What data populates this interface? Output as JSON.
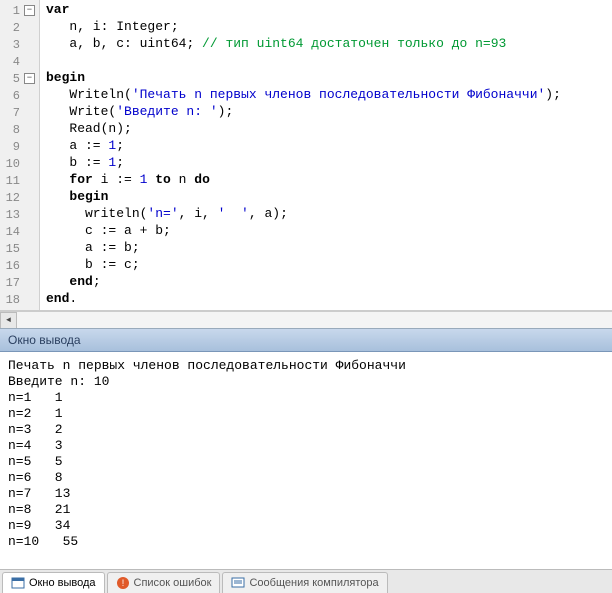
{
  "code": {
    "lines": [
      {
        "n": 1,
        "fold": true,
        "tokens": [
          {
            "t": "kw",
            "v": "var"
          }
        ]
      },
      {
        "n": 2,
        "tokens": [
          {
            "t": "",
            "v": "   n, i: "
          },
          {
            "t": "type",
            "v": "Integer"
          },
          {
            "t": "",
            "v": ";"
          }
        ]
      },
      {
        "n": 3,
        "tokens": [
          {
            "t": "",
            "v": "   a, b, c: "
          },
          {
            "t": "type",
            "v": "uint64"
          },
          {
            "t": "",
            "v": "; "
          },
          {
            "t": "cmt",
            "v": "// тип uint64 достаточен только до n=93"
          }
        ]
      },
      {
        "n": 4,
        "tokens": []
      },
      {
        "n": 5,
        "fold": true,
        "tokens": [
          {
            "t": "kw",
            "v": "begin"
          }
        ]
      },
      {
        "n": 6,
        "tokens": [
          {
            "t": "",
            "v": "   Writeln("
          },
          {
            "t": "str",
            "v": "'Печать n первых членов последовательности Фибоначчи'"
          },
          {
            "t": "",
            "v": ");"
          }
        ]
      },
      {
        "n": 7,
        "tokens": [
          {
            "t": "",
            "v": "   Write("
          },
          {
            "t": "str",
            "v": "'Введите n: '"
          },
          {
            "t": "",
            "v": ");"
          }
        ]
      },
      {
        "n": 8,
        "tokens": [
          {
            "t": "",
            "v": "   Read(n);"
          }
        ]
      },
      {
        "n": 9,
        "tokens": [
          {
            "t": "",
            "v": "   a := "
          },
          {
            "t": "num",
            "v": "1"
          },
          {
            "t": "",
            "v": ";"
          }
        ]
      },
      {
        "n": 10,
        "tokens": [
          {
            "t": "",
            "v": "   b := "
          },
          {
            "t": "num",
            "v": "1"
          },
          {
            "t": "",
            "v": ";"
          }
        ]
      },
      {
        "n": 11,
        "tokens": [
          {
            "t": "",
            "v": "   "
          },
          {
            "t": "kw",
            "v": "for"
          },
          {
            "t": "",
            "v": " i := "
          },
          {
            "t": "num",
            "v": "1"
          },
          {
            "t": "",
            "v": " "
          },
          {
            "t": "kw",
            "v": "to"
          },
          {
            "t": "",
            "v": " n "
          },
          {
            "t": "kw",
            "v": "do"
          }
        ]
      },
      {
        "n": 12,
        "tokens": [
          {
            "t": "",
            "v": "   "
          },
          {
            "t": "kw",
            "v": "begin"
          }
        ]
      },
      {
        "n": 13,
        "tokens": [
          {
            "t": "",
            "v": "     writeln("
          },
          {
            "t": "str",
            "v": "'n='"
          },
          {
            "t": "",
            "v": ", i, "
          },
          {
            "t": "str",
            "v": "'  '"
          },
          {
            "t": "",
            "v": ", a);"
          }
        ]
      },
      {
        "n": 14,
        "tokens": [
          {
            "t": "",
            "v": "     c := a + b;"
          }
        ]
      },
      {
        "n": 15,
        "tokens": [
          {
            "t": "",
            "v": "     a := b;"
          }
        ]
      },
      {
        "n": 16,
        "tokens": [
          {
            "t": "",
            "v": "     b := c;"
          }
        ]
      },
      {
        "n": 17,
        "tokens": [
          {
            "t": "",
            "v": "   "
          },
          {
            "t": "kw",
            "v": "end"
          },
          {
            "t": "",
            "v": ";"
          }
        ]
      },
      {
        "n": 18,
        "tokens": [
          {
            "t": "kw",
            "v": "end"
          },
          {
            "t": "",
            "v": "."
          }
        ]
      }
    ]
  },
  "output": {
    "title": "Окно вывода",
    "lines": [
      "Печать n первых членов последовательности Фибоначчи",
      "Введите n: 10",
      "n=1   1",
      "n=2   1",
      "n=3   2",
      "n=4   3",
      "n=5   5",
      "n=6   8",
      "n=7   13",
      "n=8   21",
      "n=9   34",
      "n=10   55"
    ]
  },
  "tabs": [
    {
      "label": "Окно вывода",
      "active": true,
      "icon": "output"
    },
    {
      "label": "Список ошибок",
      "active": false,
      "icon": "errors"
    },
    {
      "label": "Сообщения компилятора",
      "active": false,
      "icon": "messages"
    }
  ]
}
